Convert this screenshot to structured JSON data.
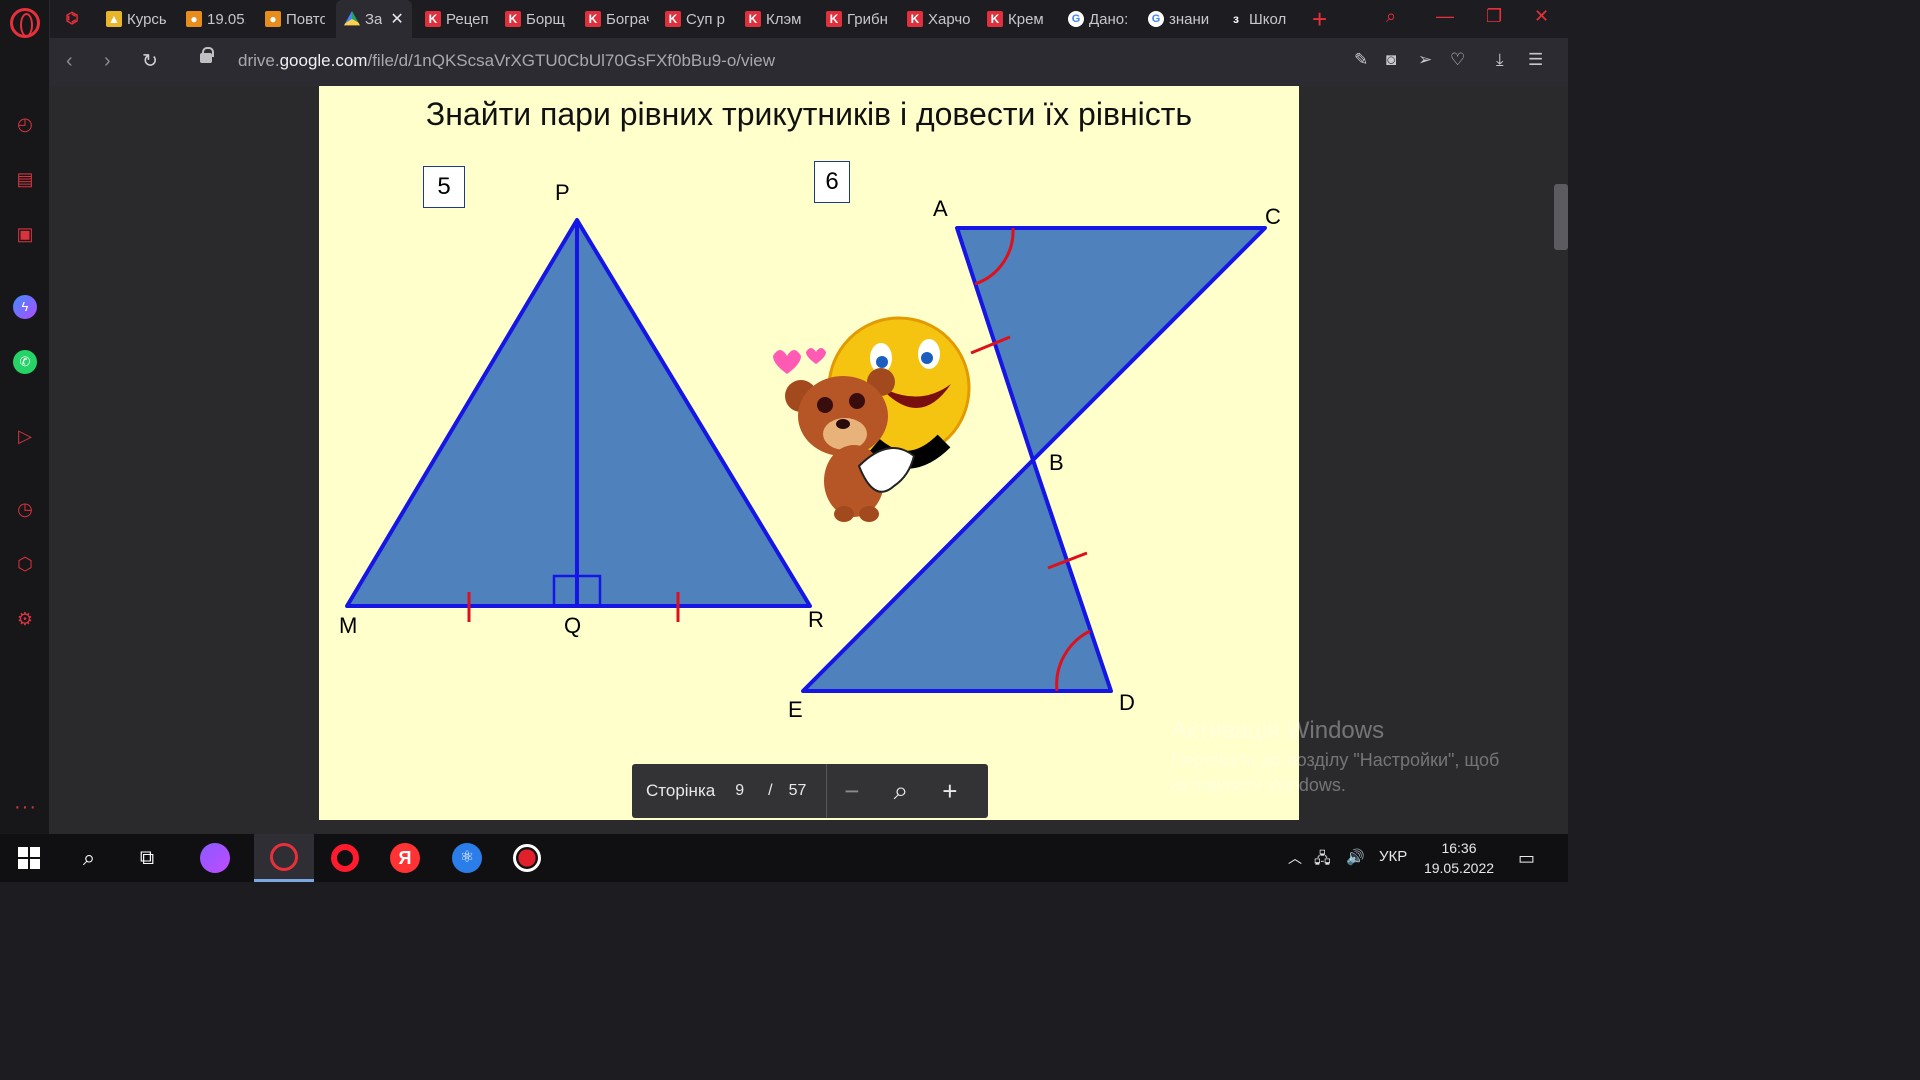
{
  "browser": {
    "tabs": [
      {
        "label": "Курсы",
        "icon": "image-icon"
      },
      {
        "label": "19.05.",
        "icon": "person-icon"
      },
      {
        "label": "Повто",
        "icon": "person-icon"
      },
      {
        "label": "За",
        "icon": "google-drive-icon",
        "active": true
      },
      {
        "label": "Рецеп",
        "icon": "k-icon"
      },
      {
        "label": "Борщ",
        "icon": "k-icon"
      },
      {
        "label": "Бограч",
        "icon": "k-icon"
      },
      {
        "label": "Суп р",
        "icon": "k-icon"
      },
      {
        "label": "Клэм",
        "icon": "k-icon"
      },
      {
        "label": "Грибн",
        "icon": "k-icon"
      },
      {
        "label": "Харчо",
        "icon": "k-icon"
      },
      {
        "label": "Крем",
        "icon": "k-icon"
      },
      {
        "label": "Дано:",
        "icon": "google-icon"
      },
      {
        "label": "знани",
        "icon": "google-icon"
      },
      {
        "label": "Школ",
        "icon": "school-icon"
      }
    ],
    "url_prefix": "drive.",
    "url_domain": "google.com",
    "url_path": "/file/d/1nQKScsaVrXGTU0CbUl70GsFXf0bBu9-o/view"
  },
  "slide": {
    "title": "Знайти пари рівних трикутників і довести їх рівність",
    "box5": "5",
    "box6": "6",
    "labels": {
      "P": "P",
      "M": "M",
      "Q": "Q",
      "R": "R",
      "A": "A",
      "C": "C",
      "B": "B",
      "E": "E",
      "D": "D"
    }
  },
  "pager": {
    "label": "Сторінка",
    "current": "9",
    "separator": "/",
    "total": "57"
  },
  "watermark": {
    "title": "Активація Windows",
    "text": "Перейдіть до розділу \"Настройки\", щоб активувати Windows."
  },
  "taskbar": {
    "lang": "УКР",
    "time": "16:36",
    "date": "19.05.2022"
  },
  "colors": {
    "triangle_fill": "#4f81bd",
    "triangle_stroke": "#1515e6",
    "marks": "#e0101a",
    "slide_bg": "#ffffcc",
    "accent": "#e8303a"
  }
}
